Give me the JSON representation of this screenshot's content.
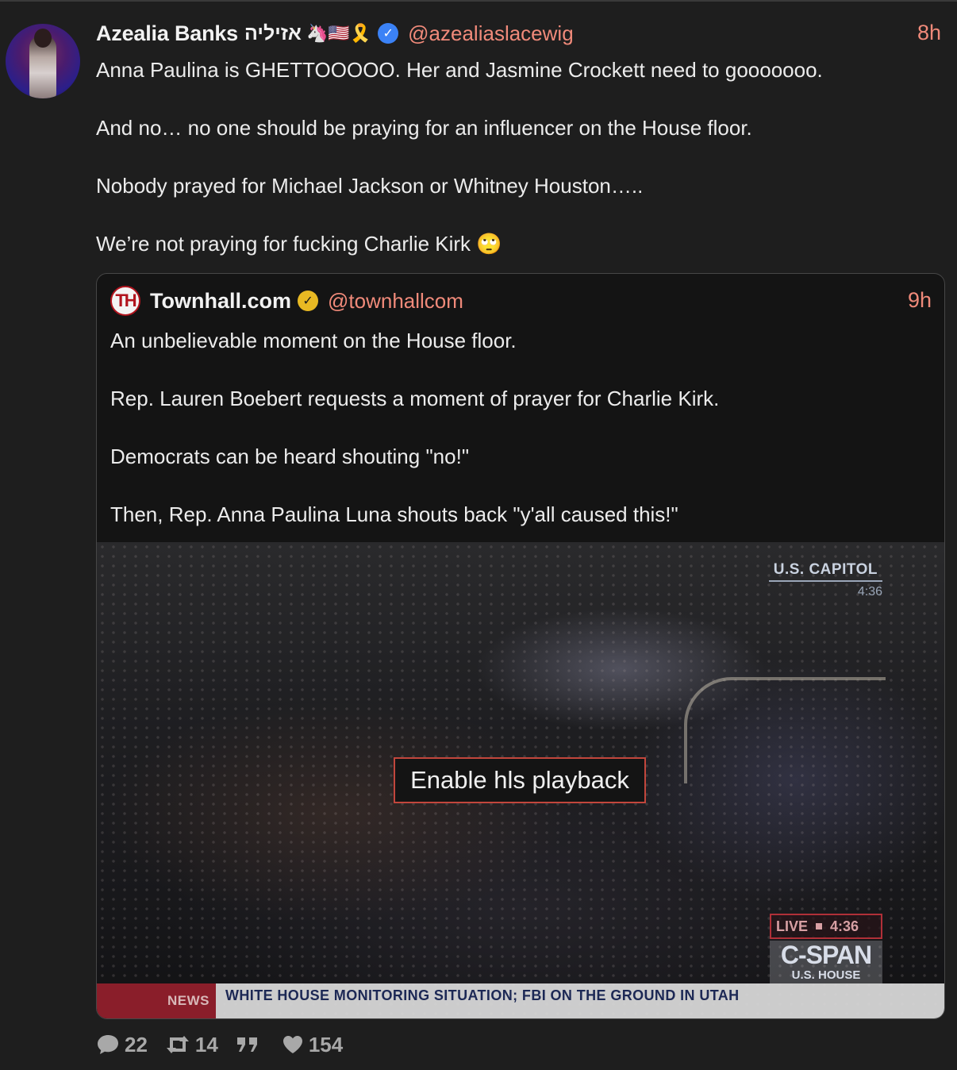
{
  "post": {
    "author_name": "Azealia Banks",
    "author_hebrew": "אזיליה",
    "author_emoji": "🦄🇺🇸🎗️",
    "handle": "@azealiaslacewig",
    "time": "8h",
    "paragraphs": [
      "Anna Paulina is GHETTOOOOO. Her and Jasmine Crockett need to gooooooo.",
      "And no… no one should be praying for an influencer on the House floor.",
      "Nobody prayed for Michael Jackson or Whitney Houston…..",
      "We’re not praying for fucking Charlie Kirk 🙄"
    ]
  },
  "quote": {
    "logo_text": "TH",
    "author_name": "Townhall.com",
    "handle": "@townhallcom",
    "time": "9h",
    "paragraphs": [
      "An unbelievable moment on the House floor.",
      "Rep. Lauren Boebert requests a moment of prayer for Charlie Kirk.",
      "Democrats can be heard shouting \"no!\"",
      "Then, Rep. Anna Paulina Luna shouts back \"y'all caused this!\""
    ],
    "video": {
      "location_label": "U.S. CAPITOL",
      "location_time": "4:36",
      "enable_label": "Enable hls playback",
      "live_label": "LIVE",
      "live_time": "4:36",
      "network": "C-SPAN",
      "network_sub": "U.S. HOUSE",
      "ticker_tag": "NEWS",
      "ticker_text": "WHITE HOUSE MONITORING SITUATION; FBI ON THE GROUND IN UTAH"
    }
  },
  "actions": {
    "replies": "22",
    "reposts": "14",
    "likes": "154"
  },
  "colors": {
    "accent": "#f08a7a",
    "verified_blue": "#3b82f6",
    "verified_gold": "#e8b923"
  }
}
